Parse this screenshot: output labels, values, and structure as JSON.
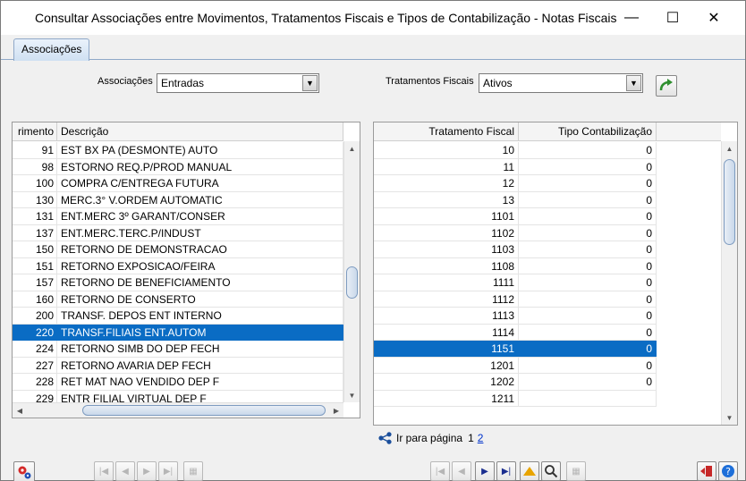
{
  "window": {
    "title": "Consultar Associações entre Movimentos, Tratamentos Fiscais e Tipos de Contabilização - Notas Fiscais",
    "minimize": "—",
    "maximize": "☐",
    "close": "✕"
  },
  "tabs": [
    {
      "label": "Associações"
    }
  ],
  "filters": {
    "associacoes_label": "Associações",
    "associacoes_value": "Entradas",
    "tratamentos_label": "Tratamentos Fiscais",
    "tratamentos_value": "Ativos"
  },
  "left_grid": {
    "columns": [
      "rimento",
      "Descrição"
    ],
    "rows": [
      {
        "code": "91",
        "desc": "EST BX PA (DESMONTE) AUTO"
      },
      {
        "code": "98",
        "desc": "ESTORNO REQ.P/PROD MANUAL"
      },
      {
        "code": "100",
        "desc": "COMPRA C/ENTREGA FUTURA"
      },
      {
        "code": "130",
        "desc": "MERC.3° V.ORDEM AUTOMATIC"
      },
      {
        "code": "131",
        "desc": "ENT.MERC 3º GARANT/CONSER"
      },
      {
        "code": "137",
        "desc": "ENT.MERC.TERC.P/INDUST"
      },
      {
        "code": "150",
        "desc": "RETORNO DE DEMONSTRACAO"
      },
      {
        "code": "151",
        "desc": "RETORNO EXPOSICAO/FEIRA"
      },
      {
        "code": "157",
        "desc": "RETORNO DE BENEFICIAMENTO"
      },
      {
        "code": "160",
        "desc": "RETORNO DE CONSERTO"
      },
      {
        "code": "200",
        "desc": "TRANSF. DEPOS ENT INTERNO"
      },
      {
        "code": "220",
        "desc": "TRANSF.FILIAIS ENT.AUTOM"
      },
      {
        "code": "224",
        "desc": "RETORNO SIMB DO DEP FECH"
      },
      {
        "code": "227",
        "desc": "RETORNO AVARIA DEP FECH"
      },
      {
        "code": "228",
        "desc": "RET MAT NAO VENDIDO DEP F"
      },
      {
        "code": "229",
        "desc": "ENTR FILIAL VIRTUAL DEP F"
      }
    ],
    "selected_index": 11
  },
  "right_grid": {
    "columns": [
      "Tratamento Fiscal",
      "Tipo Contabilização"
    ],
    "rows": [
      {
        "trat": "10",
        "tipo": "0"
      },
      {
        "trat": "11",
        "tipo": "0"
      },
      {
        "trat": "12",
        "tipo": "0"
      },
      {
        "trat": "13",
        "tipo": "0"
      },
      {
        "trat": "1101",
        "tipo": "0"
      },
      {
        "trat": "1102",
        "tipo": "0"
      },
      {
        "trat": "1103",
        "tipo": "0"
      },
      {
        "trat": "1108",
        "tipo": "0"
      },
      {
        "trat": "1111",
        "tipo": "0"
      },
      {
        "trat": "1112",
        "tipo": "0"
      },
      {
        "trat": "1113",
        "tipo": "0"
      },
      {
        "trat": "1114",
        "tipo": "0"
      },
      {
        "trat": "1151",
        "tipo": "0"
      },
      {
        "trat": "1201",
        "tipo": "0"
      },
      {
        "trat": "1202",
        "tipo": "0"
      },
      {
        "trat": "1211",
        "tipo": ""
      }
    ],
    "selected_index": 12
  },
  "pager": {
    "label": "Ir para página",
    "current": "1",
    "next": "2"
  },
  "nav_glyphs": {
    "first": "|◀",
    "prev": "◀",
    "next": "▶",
    "last": "▶|",
    "grid": "▦"
  },
  "colors": {
    "selection": "#0a6cc4",
    "link": "#0033cc"
  }
}
